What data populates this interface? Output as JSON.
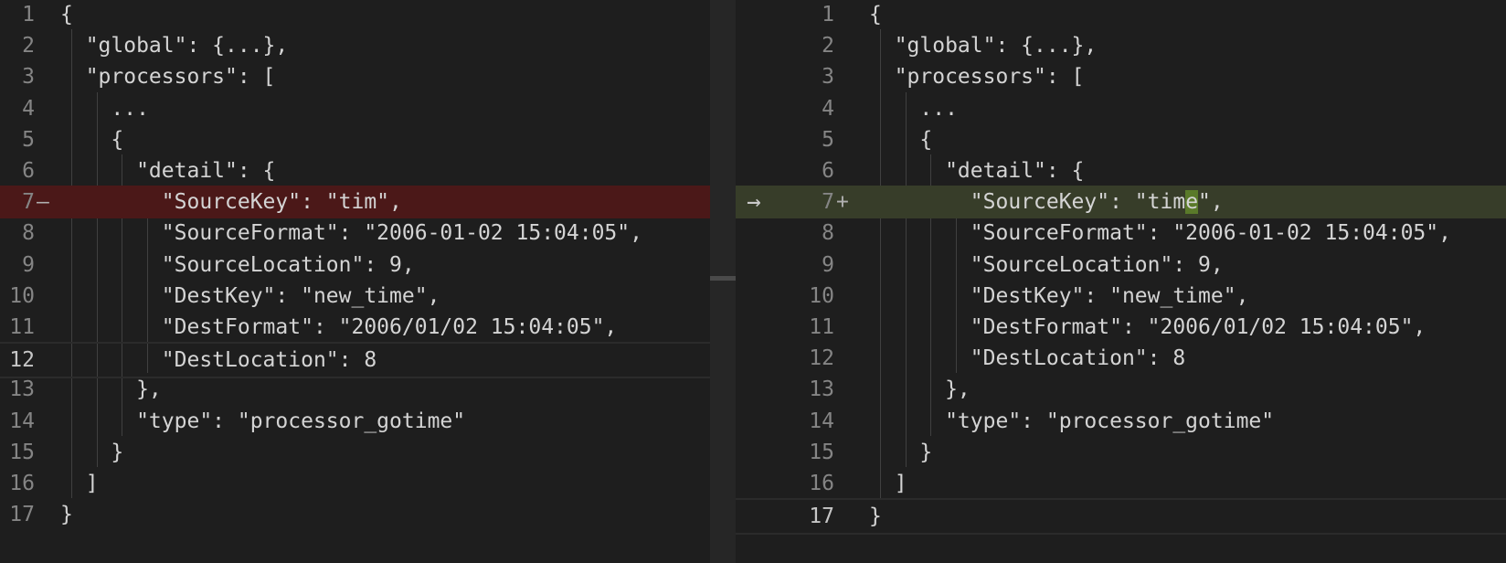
{
  "colors": {
    "background": "#1e1e1e",
    "removed_line": "#4b1818",
    "added_line": "#373d29",
    "line_number": "#858585",
    "text": "#d4d4d4"
  },
  "left_pane": {
    "lines": [
      {
        "n": "1",
        "text": "{"
      },
      {
        "n": "2",
        "text": "  \"global\": {...},"
      },
      {
        "n": "3",
        "text": "  \"processors\": ["
      },
      {
        "n": "4",
        "text": "    ..."
      },
      {
        "n": "5",
        "text": "    {"
      },
      {
        "n": "6",
        "text": "      \"detail\": {"
      },
      {
        "n": "7",
        "text": "        \"SourceKey\": \"tim\",",
        "marker": "—",
        "state": "removed"
      },
      {
        "n": "8",
        "text": "        \"SourceFormat\": \"2006-01-02 15:04:05\","
      },
      {
        "n": "9",
        "text": "        \"SourceLocation\": 9,"
      },
      {
        "n": "10",
        "text": "        \"DestKey\": \"new_time\","
      },
      {
        "n": "11",
        "text": "        \"DestFormat\": \"2006/01/02 15:04:05\","
      },
      {
        "n": "12",
        "text": "        \"DestLocation\": 8",
        "state": "cursor"
      },
      {
        "n": "13",
        "text": "      },"
      },
      {
        "n": "14",
        "text": "      \"type\": \"processor_gotime\""
      },
      {
        "n": "15",
        "text": "    }"
      },
      {
        "n": "16",
        "text": "  ]"
      },
      {
        "n": "17",
        "text": "}"
      }
    ]
  },
  "right_pane": {
    "changed_line_arrow": "→",
    "lines": [
      {
        "n": "1",
        "text": "{"
      },
      {
        "n": "2",
        "text": "  \"global\": {...},"
      },
      {
        "n": "3",
        "text": "  \"processors\": ["
      },
      {
        "n": "4",
        "text": "    ..."
      },
      {
        "n": "5",
        "text": "    {"
      },
      {
        "n": "6",
        "text": "      \"detail\": {"
      },
      {
        "n": "7",
        "text_before": "        \"SourceKey\": \"tim",
        "text_highlight": "e",
        "text_after": "\",",
        "marker": "+",
        "state": "added"
      },
      {
        "n": "8",
        "text": "        \"SourceFormat\": \"2006-01-02 15:04:05\","
      },
      {
        "n": "9",
        "text": "        \"SourceLocation\": 9,"
      },
      {
        "n": "10",
        "text": "        \"DestKey\": \"new_time\","
      },
      {
        "n": "11",
        "text": "        \"DestFormat\": \"2006/01/02 15:04:05\","
      },
      {
        "n": "12",
        "text": "        \"DestLocation\": 8"
      },
      {
        "n": "13",
        "text": "      },"
      },
      {
        "n": "14",
        "text": "      \"type\": \"processor_gotime\""
      },
      {
        "n": "15",
        "text": "    }"
      },
      {
        "n": "16",
        "text": "  ]"
      },
      {
        "n": "17",
        "text": "}",
        "state": "cursor"
      }
    ]
  }
}
